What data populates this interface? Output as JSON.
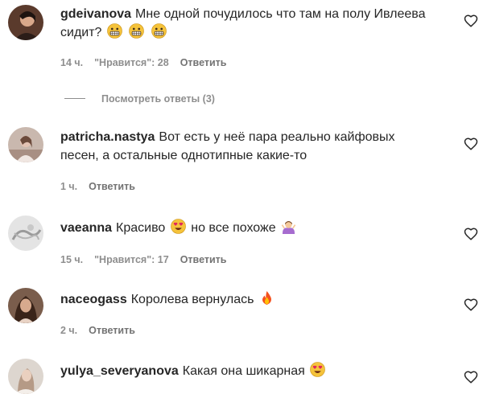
{
  "like_label": "\"Нравится\"",
  "reply_label": "Ответить",
  "comments": [
    {
      "username": "gdeivanova",
      "text": "Мне одной почудилось что там на полу Ивлеева сидит?",
      "time": "14 ч.",
      "likes": "28",
      "emojis": [
        "grimacing-face",
        "grimacing-face",
        "grimacing-face"
      ],
      "replies_label": "Посмотреть ответы (3)"
    },
    {
      "username": "patricha.nastya",
      "text": "Вот есть у неё пара реально кайфовых песен, а остальные однотипные какие-то",
      "time": "1 ч."
    },
    {
      "username": "vaeanna",
      "text_before": "Красиво",
      "text_after": "но все похоже",
      "time": "15 ч.",
      "likes": "17",
      "emojis": [
        "heart-eyes-face",
        "person-shrugging"
      ]
    },
    {
      "username": "naceogass",
      "text": "Королева вернулась",
      "time": "2 ч.",
      "emojis": [
        "fire"
      ]
    },
    {
      "username": "yulya_severyanova",
      "text": "Какая она шикарная",
      "emojis": [
        "heart-eyes-face"
      ]
    }
  ]
}
